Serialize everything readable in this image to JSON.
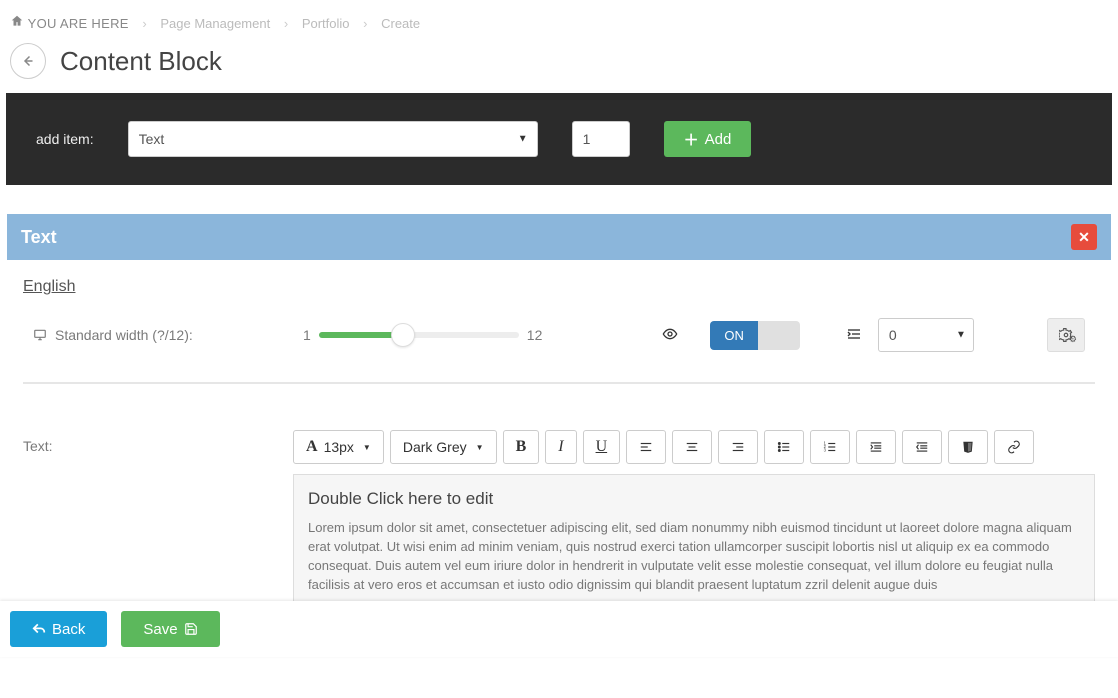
{
  "breadcrumb": {
    "here_label": "YOU ARE HERE",
    "items": [
      "Page Management",
      "Portfolio",
      "Create"
    ]
  },
  "page_title": "Content Block",
  "add_item": {
    "label": "add item:",
    "type_select": {
      "value": "Text",
      "options": [
        "Text"
      ]
    },
    "quantity": "1",
    "add_button": "Add"
  },
  "panel": {
    "title": "Text",
    "language_tab": "English",
    "width_label": "Standard width (?/12):",
    "slider_min": "1",
    "slider_max": "12",
    "toggle_on": "ON",
    "indent_select": {
      "value": "0",
      "options": [
        "0"
      ]
    },
    "text_label": "Text:",
    "toolbar": {
      "fontsize": "13px",
      "color": "Dark Grey"
    },
    "editor": {
      "title": "Double Click here to edit",
      "body": "Lorem ipsum dolor sit amet, consectetuer adipiscing elit, sed diam nonummy nibh euismod tincidunt ut laoreet dolore magna aliquam erat volutpat. Ut wisi enim ad minim veniam, quis nostrud exerci tation ullamcorper suscipit lobortis nisl ut aliquip ex ea commodo consequat. Duis autem vel eum iriure dolor in hendrerit in vulputate velit esse molestie consequat, vel illum dolore eu feugiat nulla facilisis at vero eros et accumsan et iusto odio dignissim qui blandit praesent luptatum zzril delenit augue duis"
    }
  },
  "footer": {
    "back": "Back",
    "save": "Save"
  }
}
